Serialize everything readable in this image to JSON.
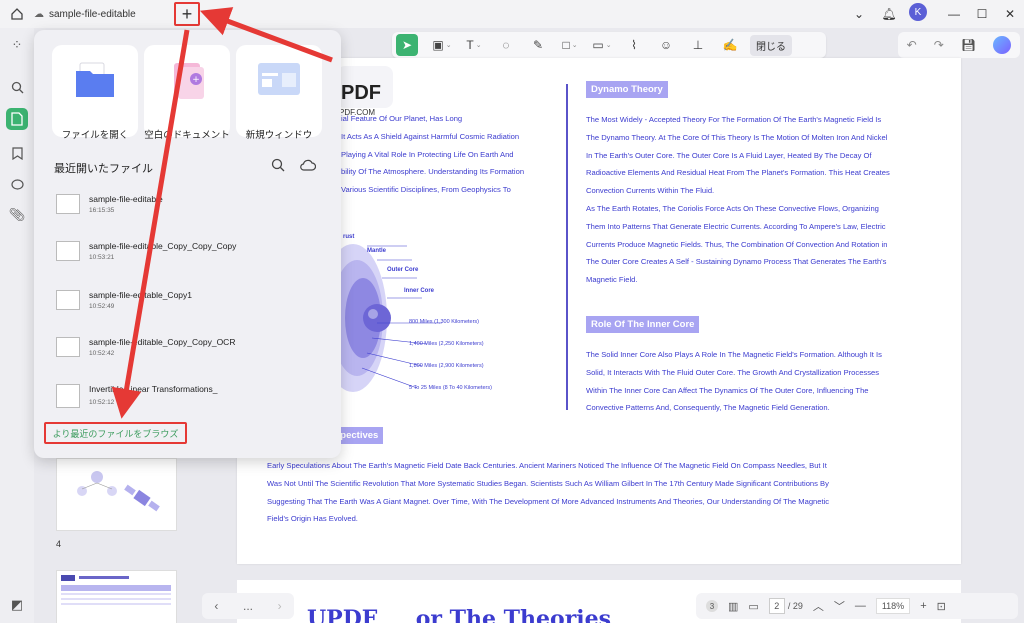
{
  "titlebar": {
    "tab_title": "sample-file-editable",
    "add_tab_symbol": "+",
    "avatar_letter": "K"
  },
  "toolbar": {
    "close_label": "閉じる"
  },
  "popup": {
    "tiles": [
      {
        "label": "ファイルを開く"
      },
      {
        "label": "空白のドキュメント"
      },
      {
        "label": "新規ウィンドウ"
      }
    ],
    "recent_title": "最近開いたファイル",
    "files": [
      {
        "name": "sample-file-editable",
        "time": "16:15:35"
      },
      {
        "name": "sample-file-editable_Copy_Copy_Copy",
        "time": "10:53:21"
      },
      {
        "name": "sample-file-editable_Copy1",
        "time": "10:52:49"
      },
      {
        "name": "sample-file-editable_Copy_Copy_OCR",
        "time": "10:52:42"
      },
      {
        "name": "Invertible Linear Transformations_",
        "time": "10:52:12"
      }
    ],
    "browse_label": "より最近のファイルをブラウズ"
  },
  "thumbnails": {
    "page_number": "4"
  },
  "document": {
    "logo_text": "PDF",
    "logo_url": "PDF.COM",
    "left_para_lines": [
      "ial Feature Of Our Planet, Has Long",
      "It Acts As A Shield Against Harmful Cosmic Radiation",
      "Playing A Vital Role In Protecting Life On Earth And",
      "bility Of The Atmosphere. Understanding Its Formation",
      "Various Scientific Disciplines, From Geophysics To"
    ],
    "diagram_labels": {
      "crust": "rust",
      "mantle": "Mantle",
      "outer_core": "Outer Core",
      "inner_core": "Inner Core",
      "d1": "800 Miles (1,300 Kilometers)",
      "d2": "1,400 Miles (2,250 Kilometers)",
      "d3": "1,800 Miles (2,900 Kilometers)",
      "d4": "5 To 25 Miles (8 To 40 Kilometers)"
    },
    "dynamo_heading": "Dynamo Theory",
    "dynamo_lines": [
      "The Most Widely - Accepted Theory For The Formation Of The Earth's Magnetic Field Is",
      "The Dynamo Theory. At The Core Of This Theory Is The Motion Of Molten Iron And Nickel",
      "In The Earth's Outer Core. The Outer Core Is A Fluid Layer, Heated By The Decay Of",
      "Radioactive Elements And Residual Heat From The Planet's Formation. This Heat Creates",
      "Convection Currents Within The Fluid.",
      "As The Earth Rotates, The Coriolis Force Acts On These Convective Flows, Organizing",
      "Them Into Patterns That Generate Electric Currents. According To Ampere's Law, Electric",
      "Currents Produce Magnetic Fields. Thus, The Combination Of Convection And Rotation in",
      "The Outer Core Creates A Self - Sustaining Dynamo Process That Generates The Earth's",
      "Magnetic Field."
    ],
    "inner_core_heading": "Role Of The Inner Core",
    "inner_core_lines": [
      "The Solid Inner Core Also Plays A Role In The Magnetic Field's Formation. Although It Is",
      "Solid, It Interacts With The Fluid Outer Core. The Growth And Crystallization Processes",
      "Within The Inner Core Can Affect The Dynamics Of The Outer Core, Influencing The",
      "Convective Patterns And, Consequently, The Magnetic Field Generation."
    ],
    "perspectives_heading": "spectives",
    "perspectives_lines": [
      "Early Speculations About The Earth's Magnetic Field Date Back Centuries. Ancient Mariners Noticed The Influence Of The Magnetic Field On Compass Needles, But It",
      "Was Not Until The Scientific Revolution That More Systematic Studies Began. Scientists Such As William Gilbert In The 17th Century Made Significant Contributions By",
      "Suggesting That The Earth Was A Giant Magnet. Over Time, With The Development Of More Advanced Instruments And Theories, Our Understanding Of The Magnetic",
      "Field's Origin Has Evolved."
    ],
    "next_page_text": "UPDF     or The Theories"
  },
  "nav": {
    "more": "...",
    "current_page": "2",
    "total_pages": "/ 29",
    "zoom": "118%",
    "badge": "3"
  },
  "colors": {
    "accent_green": "#3cb371",
    "heading_purple": "#a8a4f2",
    "text_blue": "#3c3ccf",
    "annotation_red": "#e53935"
  }
}
